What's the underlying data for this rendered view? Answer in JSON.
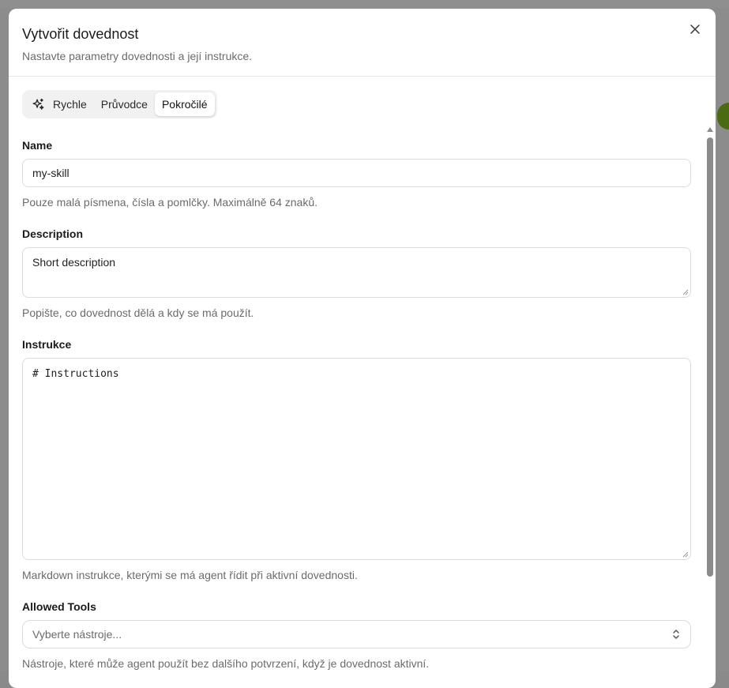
{
  "dialog": {
    "title": "Vytvořit dovednost",
    "subtitle": "Nastavte parametry dovednosti a její instrukce."
  },
  "tabs": [
    {
      "label": "Rychle",
      "icon": "sparkles-icon",
      "active": false
    },
    {
      "label": "Průvodce",
      "active": false
    },
    {
      "label": "Pokročilé",
      "active": true
    }
  ],
  "fields": {
    "name": {
      "label": "Name",
      "value": "my-skill",
      "hint": "Pouze malá písmena, čísla a pomlčky. Maximálně 64 znaků."
    },
    "description": {
      "label": "Description",
      "value": "Short description",
      "hint": "Popište, co dovednost dělá a kdy se má použít."
    },
    "instructions": {
      "label": "Instrukce",
      "value": "# Instructions",
      "hint": "Markdown instrukce, kterými se má agent řídit při aktivní dovednosti."
    },
    "allowed_tools": {
      "label": "Allowed Tools",
      "placeholder": "Vyberte nástroje...",
      "hint": "Nástroje, které může agent použít bez dalšího potvrzení, když je dovednost aktivní."
    }
  },
  "colors": {
    "accent_pill": "#4b6b12",
    "border": "#dcdcdc",
    "muted_text": "#6b6b6b"
  }
}
